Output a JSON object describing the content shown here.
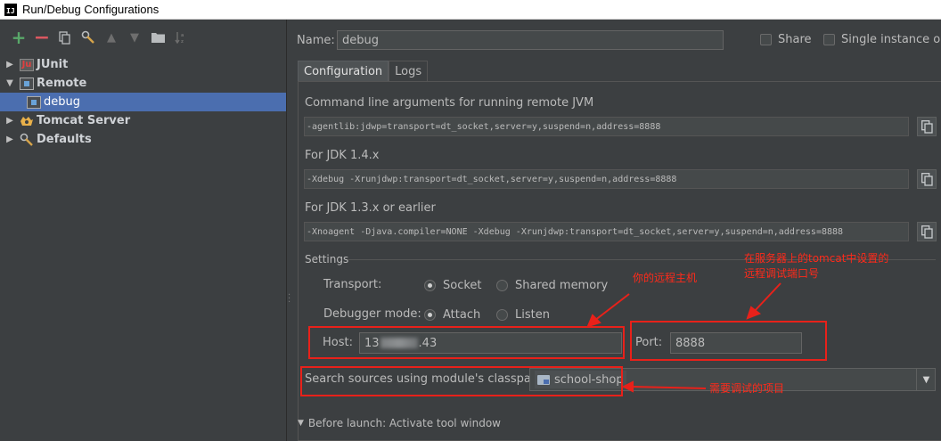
{
  "window": {
    "title": "Run/Debug Configurations"
  },
  "toolbar": {
    "icons": [
      "add-icon",
      "remove-icon",
      "copy-icon",
      "edit-defaults-icon",
      "move-up-icon",
      "move-down-icon",
      "folder-icon",
      "sort-icon"
    ]
  },
  "tree": {
    "items": [
      {
        "label": "JUnit",
        "expanded": false
      },
      {
        "label": "Remote",
        "expanded": true,
        "children": [
          {
            "label": "debug",
            "selected": true
          }
        ]
      },
      {
        "label": "Tomcat Server",
        "expanded": false
      },
      {
        "label": "Defaults",
        "expanded": false
      }
    ]
  },
  "config": {
    "name_label": "Name:",
    "name_value": "debug",
    "share_label": "Share",
    "single_instance_label": "Single instance only",
    "tabs": [
      {
        "label": "Configuration",
        "active": true
      },
      {
        "label": "Logs",
        "active": false
      }
    ],
    "cmd_label": "Command line arguments for running remote JVM",
    "cmd_value": "-agentlib:jdwp=transport=dt_socket,server=y,suspend=n,address=8888",
    "jdk14_label": "For JDK 1.4.x",
    "jdk14_value": "-Xdebug -Xrunjdwp:transport=dt_socket,server=y,suspend=n,address=8888",
    "jdk13_label": "For JDK 1.3.x or earlier",
    "jdk13_value": "-Xnoagent -Djava.compiler=NONE -Xdebug -Xrunjdwp:transport=dt_socket,server=y,suspend=n,address=8888",
    "settings_label": "Settings",
    "transport_label": "Transport:",
    "transport_options": [
      {
        "label": "Socket",
        "selected": true
      },
      {
        "label": "Shared memory",
        "selected": false
      }
    ],
    "debugger_mode_label": "Debugger mode:",
    "debugger_mode_options": [
      {
        "label": "Attach",
        "selected": true
      },
      {
        "label": "Listen",
        "selected": false
      }
    ],
    "host_label": "Host:",
    "host_value_start": "13",
    "host_value_end": ".43",
    "port_label": "Port:",
    "port_value": "8888",
    "classpath_label": "Search sources using module's classpath:",
    "classpath_module": "school-shop",
    "before_launch_label": "Before launch: Activate tool window"
  },
  "annotations": {
    "host_note": "你的远程主机",
    "port_note_line1": "在服务器上的tomcat中设置的",
    "port_note_line2": "远程调试端口号",
    "module_note": "需要调试的项目",
    "color": "#e8211a"
  },
  "colors": {
    "background": "#3c3f41",
    "selection": "#4b6eaf",
    "add": "#59a869",
    "remove": "#db5860"
  }
}
